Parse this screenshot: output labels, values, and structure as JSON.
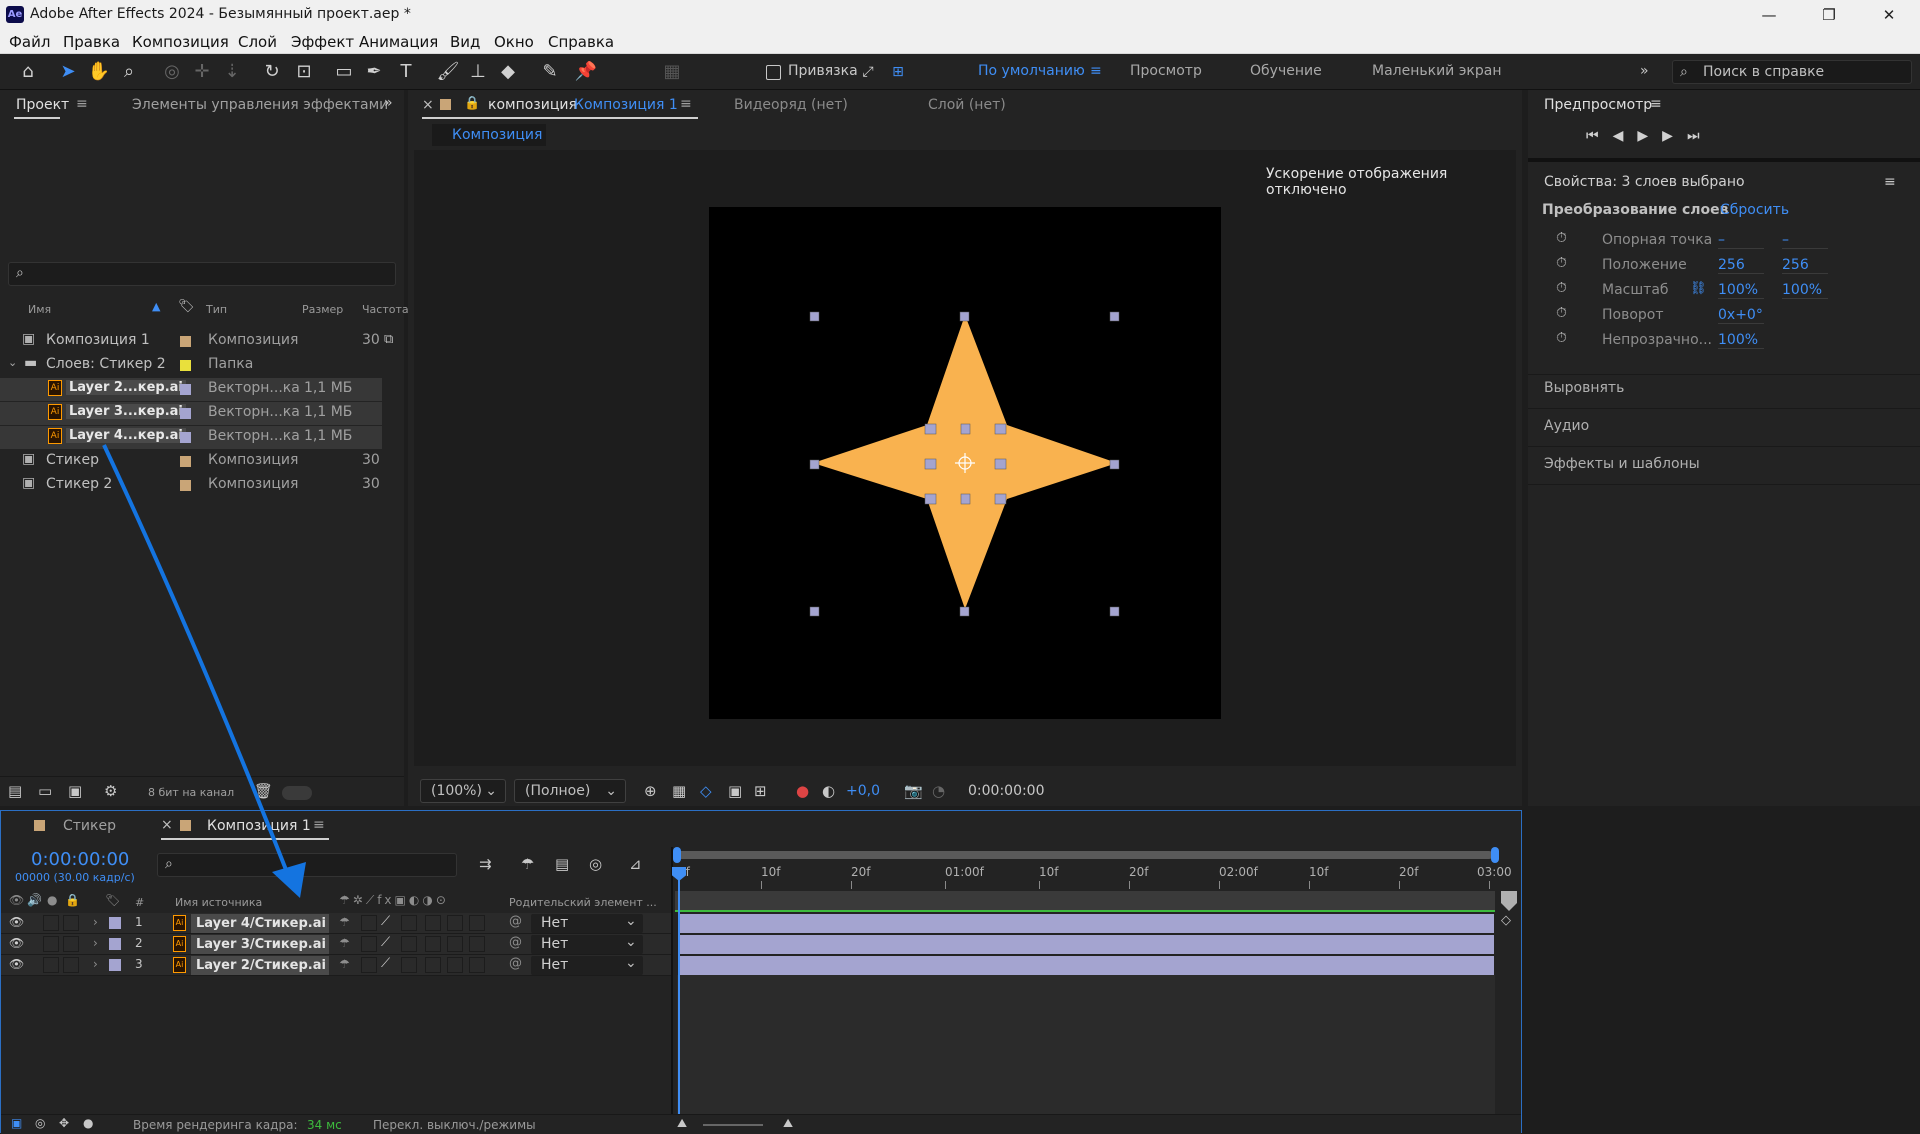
{
  "window": {
    "title": "Adobe After Effects 2024 - Безымянный проект.aep *",
    "app_badge": "Ae"
  },
  "menu": [
    "Файл",
    "Правка",
    "Композиция",
    "Слой",
    "Эффект",
    "Анимация",
    "Вид",
    "Окно",
    "Справка"
  ],
  "toolbar": {
    "snap_label": "Привязка",
    "workspaces": [
      "По умолчанию",
      "Просмотр",
      "Обучение",
      "Маленький экран"
    ],
    "search_placeholder": "Поиск в справке"
  },
  "project_panel": {
    "tab_project": "Проект",
    "tab_effects": "Элементы управления эффектами",
    "columns": [
      "Имя",
      "Тип",
      "Размер",
      "Частота"
    ],
    "items": [
      {
        "name": "Композиция 1",
        "color": "#c9a577",
        "type": "Композиция",
        "size": "",
        "rate": "30",
        "indent": 0,
        "kind": "comp"
      },
      {
        "name": "Слоев: Стикер 2",
        "color": "#e9e03c",
        "type": "Папка",
        "size": "",
        "rate": "",
        "indent": 0,
        "kind": "folder"
      },
      {
        "name": "Layer 2...кер.ai",
        "color": "#a4a4d0",
        "type": "Векторн...ка",
        "size": "1,1 МБ",
        "rate": "",
        "indent": 1,
        "kind": "ai",
        "selected": true
      },
      {
        "name": "Layer 3...кер.ai",
        "color": "#a4a4d0",
        "type": "Векторн...ка",
        "size": "1,1 МБ",
        "rate": "",
        "indent": 1,
        "kind": "ai",
        "selected": true
      },
      {
        "name": "Layer 4...кер.ai",
        "color": "#a4a4d0",
        "type": "Векторн...ка",
        "size": "1,1 МБ",
        "rate": "",
        "indent": 1,
        "kind": "ai",
        "selected": true
      },
      {
        "name": "Стикер",
        "color": "#c9a577",
        "type": "Композиция",
        "size": "",
        "rate": "30",
        "indent": 0,
        "kind": "comp"
      },
      {
        "name": "Стикер 2",
        "color": "#c9a577",
        "type": "Композиция",
        "size": "",
        "rate": "30",
        "indent": 0,
        "kind": "comp"
      }
    ],
    "bit_depth": "8 бит на канал"
  },
  "comp_viewer": {
    "tab_prefix": "композиция",
    "tab_name": "Композиция 1",
    "tab_footage": "Видеоряд  (нет)",
    "tab_layer": "Слой  (нет)",
    "breadcrumb": "Композиция 1",
    "gpu_notice": "Ускорение отображения отключено",
    "zoom": "(100%)",
    "resolution": "(Полное)",
    "exposure": "+0,0",
    "timecode": "0:00:00:00",
    "shape_color": "#f9b24f"
  },
  "right_panel": {
    "preview_title": "Предпросмотр",
    "properties_title": "Свойства: 3 слоев выбрано",
    "transform_label": "Преобразование слоев",
    "reset": "Сбросить",
    "props": [
      {
        "label": "Опорная точка",
        "v1": "–",
        "v2": "–"
      },
      {
        "label": "Положение",
        "v1": "256",
        "v2": "256"
      },
      {
        "label": "Масштаб",
        "v1": "100%",
        "v2": "100%"
      },
      {
        "label": "Поворот",
        "v1": "0x+0°",
        "v2": ""
      },
      {
        "label": "Непрозрачно...",
        "v1": "100%",
        "v2": ""
      }
    ],
    "sections": [
      "Выровнять",
      "Аудио",
      "Эффекты и шаблоны"
    ]
  },
  "timeline": {
    "tabs": [
      "Стикер",
      "Композиция 1"
    ],
    "timecode": "0:00:00:00",
    "frame_info": "00000 (30.00 кадр/с)",
    "col_source": "Имя источника",
    "col_parent": "Родительский элемент ...",
    "col_num": "#",
    "ruler": [
      "0f",
      "10f",
      "20f",
      "01:00f",
      "10f",
      "20f",
      "02:00f",
      "10f",
      "20f",
      "03:00"
    ],
    "layers": [
      {
        "num": "1",
        "name": "Layer 4/Стикер.ai",
        "parent": "Нет"
      },
      {
        "num": "2",
        "name": "Layer 3/Стикер.ai",
        "parent": "Нет"
      },
      {
        "num": "3",
        "name": "Layer 2/Стикер.ai",
        "parent": "Нет"
      }
    ],
    "render_label": "Время рендеринга кадра:",
    "render_value": "34 мс",
    "toggle_label": "Перекл. выключ./режимы"
  },
  "annotation_color": "#1474e0"
}
